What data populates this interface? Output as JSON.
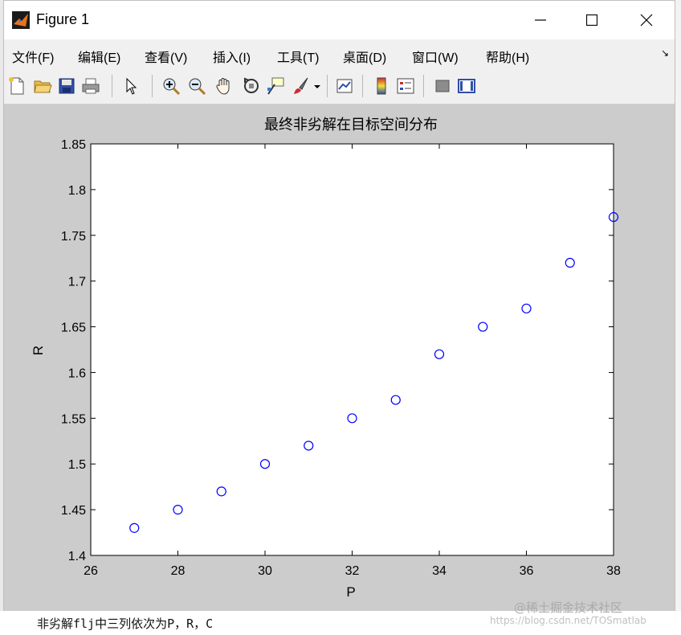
{
  "window": {
    "title": "Figure 1"
  },
  "menu": {
    "items": [
      "文件(F)",
      "编辑(E)",
      "查看(V)",
      "插入(I)",
      "工具(T)",
      "桌面(D)",
      "窗口(W)",
      "帮助(H)"
    ]
  },
  "toolbar": {
    "icons": [
      "new-file-icon",
      "open-folder-icon",
      "save-icon",
      "print-icon",
      "pointer-icon",
      "zoom-in-icon",
      "zoom-out-icon",
      "pan-hand-icon",
      "rotate-3d-icon",
      "data-cursor-icon",
      "brush-icon",
      "dropdown-arrow-icon",
      "link-plot-icon",
      "colorbar-icon",
      "legend-icon",
      "hide-plot-tools-icon",
      "show-plot-tools-icon"
    ]
  },
  "colors": {
    "marker": "#0000ff",
    "figure_bg": "#cccccc",
    "axes_bg": "#ffffff"
  },
  "chart_data": {
    "type": "scatter",
    "title": "最终非劣解在目标空间分布",
    "xlabel": "P",
    "ylabel": "R",
    "xlim": [
      26,
      38
    ],
    "ylim": [
      1.4,
      1.85
    ],
    "xticks": [
      "26",
      "28",
      "30",
      "32",
      "34",
      "36",
      "38"
    ],
    "yticks": [
      "1.4",
      "1.45",
      "1.5",
      "1.55",
      "1.6",
      "1.65",
      "1.7",
      "1.75",
      "1.8",
      "1.85"
    ],
    "xtick_values": [
      26,
      28,
      30,
      32,
      34,
      36,
      38
    ],
    "ytick_values": [
      1.4,
      1.45,
      1.5,
      1.55,
      1.6,
      1.65,
      1.7,
      1.75,
      1.8,
      1.85
    ],
    "marker": "open-circle",
    "grid": false,
    "series": [
      {
        "x": [
          27,
          28,
          29,
          30,
          31,
          32,
          33,
          34,
          35,
          36,
          37,
          38
        ],
        "y": [
          1.43,
          1.45,
          1.47,
          1.5,
          1.52,
          1.55,
          1.57,
          1.62,
          1.65,
          1.67,
          1.72,
          1.77
        ]
      }
    ]
  },
  "footer": {
    "text": "非劣解flj中三列依次为P，R，C",
    "watermark_main": "@稀土掘金技术社区",
    "watermark_url": "https://blog.csdn.net/TOSmatlab"
  }
}
